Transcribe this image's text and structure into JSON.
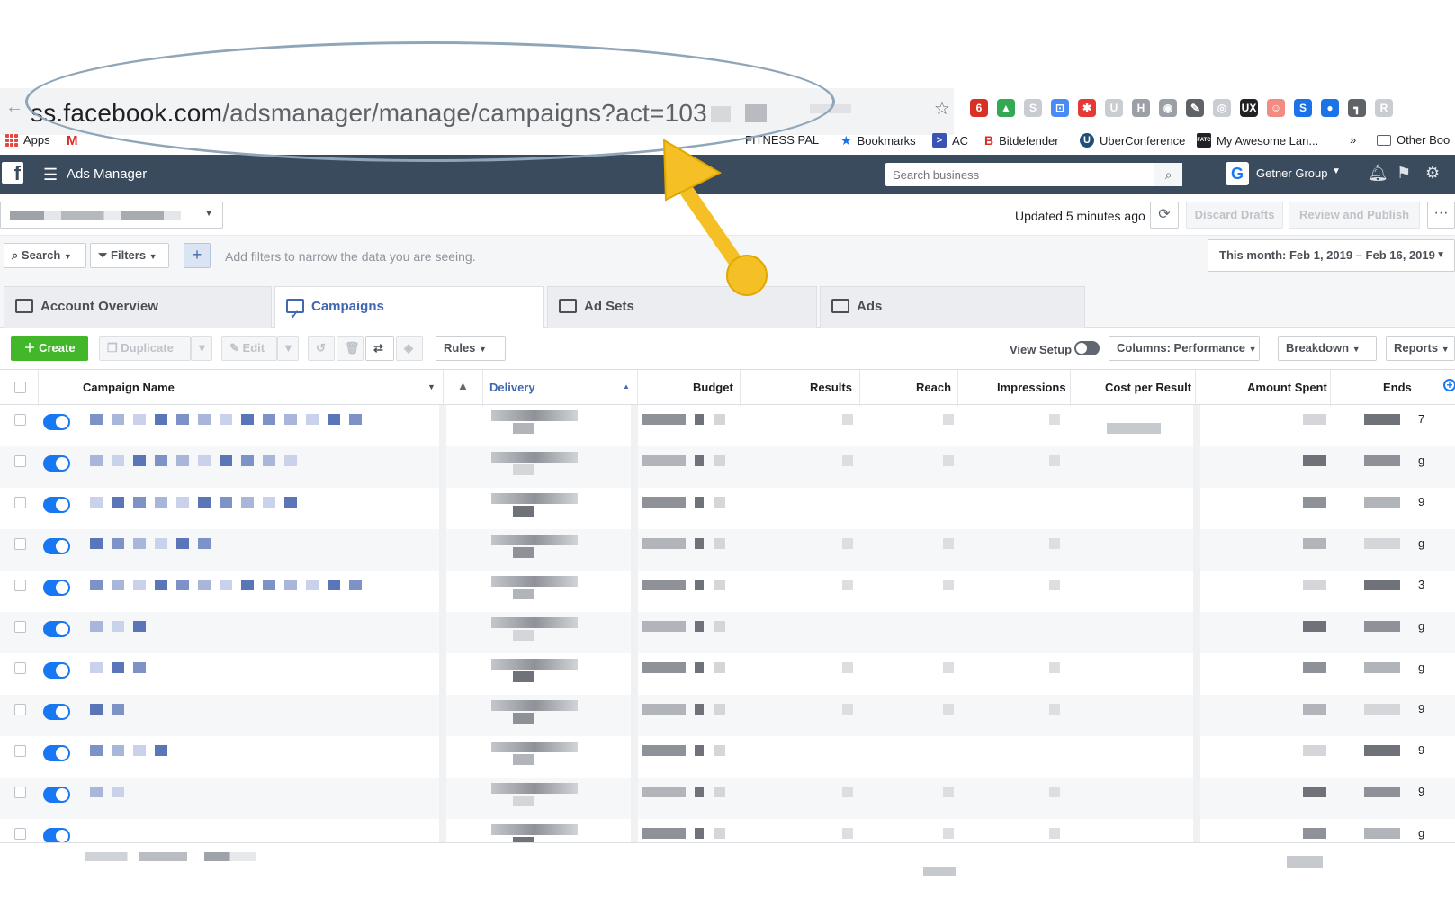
{
  "browser": {
    "url_host": "ss.facebook.com",
    "url_path": "/adsmanager/manage/campaigns?act=103",
    "bookmarks": [
      {
        "label": "Apps",
        "icon": "apps-grid-icon"
      },
      {
        "label": "",
        "icon": "gmail-icon"
      },
      {
        "label": "FITNESS PAL",
        "icon": "fitness-icon"
      },
      {
        "label": "Bookmarks",
        "icon": "star-icon"
      },
      {
        "label": "AC",
        "icon": "ac-icon"
      },
      {
        "label": "Bitdefender",
        "icon": "bitdefender-icon"
      },
      {
        "label": "UberConference",
        "icon": "uberconference-icon"
      },
      {
        "label": "My Awesome Lan...",
        "icon": "fatc-icon"
      },
      {
        "label": "»",
        "icon": ""
      },
      {
        "label": "Other Boo",
        "icon": "folder-icon"
      }
    ]
  },
  "header": {
    "app_title": "Ads Manager",
    "search_placeholder": "Search business",
    "business_name": "Getner Group",
    "business_initial": "G"
  },
  "account_row": {
    "updated_text": "Updated 5 minutes ago",
    "discard_label": "Discard Drafts",
    "review_label": "Review and Publish",
    "more_label": "···"
  },
  "filter_row": {
    "search_label": "Search",
    "filters_label": "Filters",
    "hint": "Add filters to narrow the data you are seeing.",
    "date_range": "This month: Feb 1, 2019 – Feb 16, 2019"
  },
  "tabs": [
    {
      "label": "Account Overview"
    },
    {
      "label": "Campaigns"
    },
    {
      "label": "Ad Sets"
    },
    {
      "label": "Ads"
    }
  ],
  "toolbar": {
    "create_label": "Create",
    "duplicate_label": "Duplicate",
    "edit_label": "Edit",
    "rules_label": "Rules",
    "view_setup_label": "View Setup",
    "columns_label": "Columns: Performance",
    "breakdown_label": "Breakdown",
    "reports_label": "Reports"
  },
  "table": {
    "columns": [
      "Campaign Name",
      "Delivery",
      "Budget",
      "Results",
      "Reach",
      "Impressions",
      "Cost per Result",
      "Amount Spent",
      "Ends"
    ],
    "ends_tail": [
      "7",
      "g",
      "9",
      "g",
      "3",
      "g",
      "g",
      "9",
      "9",
      "9",
      "g"
    ]
  },
  "colors": {
    "header_bg": "#3b4b5e",
    "accent_blue": "#4267b2",
    "toggle_on": "#1877f2",
    "create_green": "#42b72a",
    "annotation_yellow": "#f4c025"
  }
}
